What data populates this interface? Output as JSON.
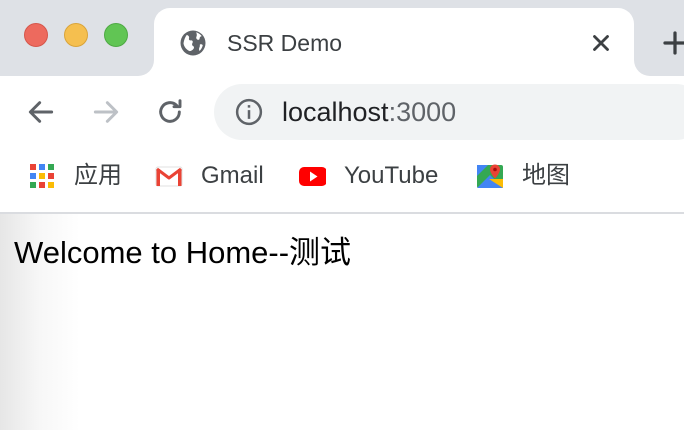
{
  "window": {
    "controls": [
      "close",
      "minimize",
      "zoom"
    ]
  },
  "tab": {
    "title": "SSR Demo",
    "favicon": "globe-icon"
  },
  "toolbar": {
    "url_host": "localhost",
    "url_port": ":3000"
  },
  "bookmarks": [
    {
      "label": "应用",
      "icon": "apps-grid-icon"
    },
    {
      "label": "Gmail",
      "icon": "gmail-icon"
    },
    {
      "label": "YouTube",
      "icon": "youtube-icon"
    },
    {
      "label": "地图",
      "icon": "maps-icon"
    }
  ],
  "page": {
    "heading": "Welcome to Home--测试"
  },
  "colors": {
    "tabstrip": "#dee1e6",
    "omnibox": "#f1f3f4",
    "close_red": "#ed6a5e",
    "minimize_yellow": "#f5bf4f",
    "zoom_green": "#61c554"
  }
}
